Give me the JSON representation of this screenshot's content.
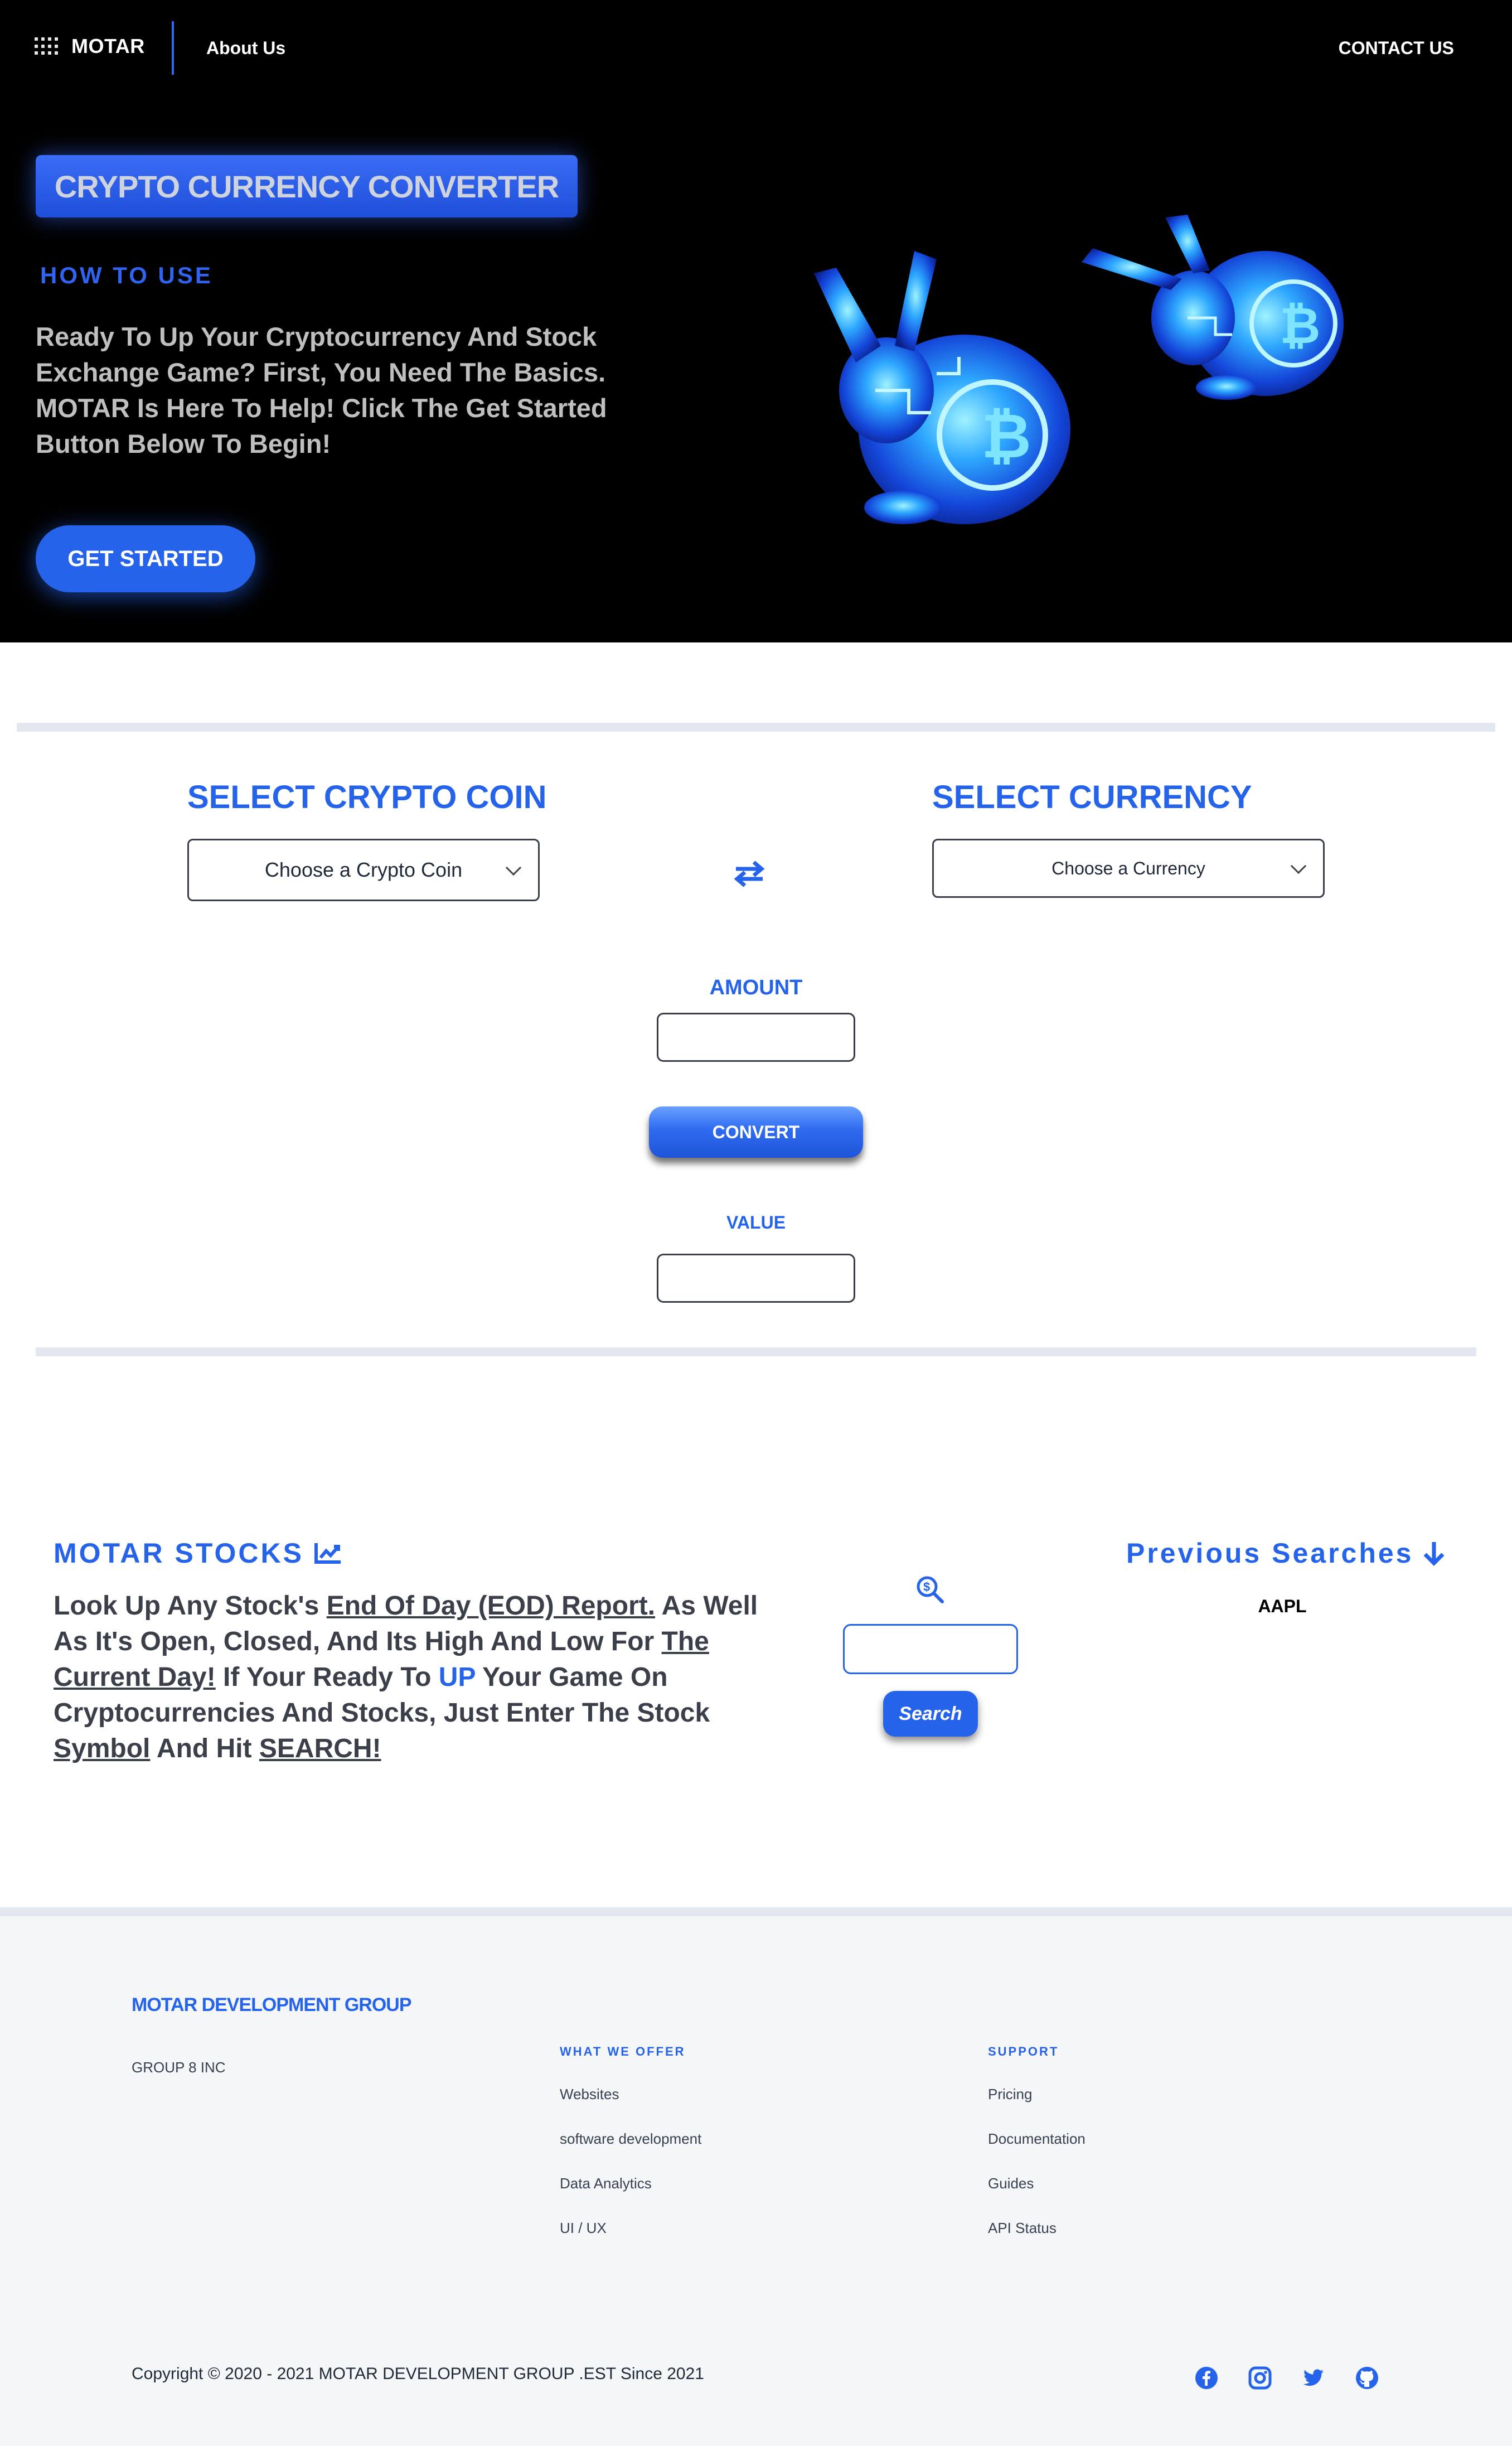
{
  "nav": {
    "logo_text": "MOTAR",
    "about_label": "About Us",
    "contact_label": "CONTACT US"
  },
  "hero": {
    "title": "CRYPTO CURRENCY CONVERTER",
    "subtitle": "HOW TO USE",
    "body": "Ready To Up Your Cryptocurrency And Stock Exchange Game? First, You Need The Basics. MOTAR Is Here To Help! Click The Get Started Button Below To Begin!",
    "cta_label": "GET STARTED"
  },
  "converter": {
    "coin_heading": "SELECT CRYPTO COIN",
    "coin_select_value": "Choose a Crypto Coin",
    "currency_heading": "SELECT CURRENCY",
    "currency_select_value": "Choose a Currency",
    "amount_label": "AMOUNT",
    "convert_label": "CONVERT",
    "value_label": "VALUE"
  },
  "stocks": {
    "heading": "MOTAR STOCKS",
    "copy": {
      "t1": "Look Up Any Stock's ",
      "l1": "End Of Day (EOD) Report.",
      "t2": " As Well As It's Open, Closed, And Its High And Low For ",
      "l2": "The Current Day!",
      "t3": " If Your Ready To ",
      "up": "UP",
      "t4": " Your Game On Cryptocurrencies And Stocks, Just Enter The Stock ",
      "l3": "Symbol",
      "t5": " And Hit ",
      "l4": "SEARCH!"
    },
    "search_label": "Search",
    "previous_heading": "Previous Searches",
    "previous_items": [
      "AAPL"
    ]
  },
  "footer": {
    "brand": "MOTAR DEVELOPMENT GROUP",
    "sub": "GROUP 8 INC",
    "offer_heading": "WHAT WE OFFER",
    "offer_links": [
      "Websites",
      "software development",
      "Data Analytics",
      "UI / UX"
    ],
    "support_heading": "SUPPORT",
    "support_links": [
      "Pricing",
      "Documentation",
      "Guides",
      "API Status"
    ],
    "copyright": "Copyright © 2020 - 2021   MOTAR DEVELOPMENT GROUP  .EST Since 2021",
    "social_icons": [
      "facebook-icon",
      "instagram-icon",
      "twitter-icon",
      "github-icon"
    ]
  },
  "colors": {
    "accent": "#2563eb",
    "hero_bg": "#000000",
    "footer_bg": "#f5f6f8",
    "divider": "#e3e7ef"
  }
}
